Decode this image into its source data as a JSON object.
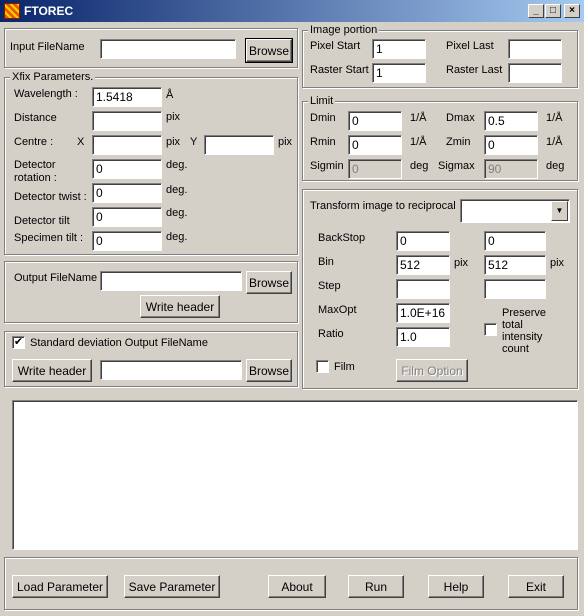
{
  "window": {
    "title": "FTOREC",
    "controls": {
      "minimize": "_",
      "maximize": "□",
      "close": "×"
    }
  },
  "input_file": {
    "label": "Input FileName",
    "value": "",
    "browse": "Browse"
  },
  "image_portion": {
    "title": "Image portion",
    "pixel_start": {
      "label": "Pixel Start",
      "value": "1"
    },
    "pixel_last": {
      "label": "Pixel Last",
      "value": ""
    },
    "raster_start": {
      "label": "Raster Start",
      "value": "1"
    },
    "raster_last": {
      "label": "Raster Last",
      "value": ""
    }
  },
  "xfix": {
    "title": "Xfix Parameters.",
    "wavelength": {
      "label": "Wavelength :",
      "value": "1.5418",
      "unit": "Å"
    },
    "distance": {
      "label": "Distance",
      "value": "",
      "unit": "pix"
    },
    "centre": {
      "label": "Centre :",
      "x_label": "X",
      "x_value": "",
      "x_unit": "pix",
      "y_label": "Y",
      "y_value": "",
      "y_unit": "pix"
    },
    "rotation": {
      "label1": "Detector",
      "label2": "rotation :",
      "value": "0",
      "unit": "deg."
    },
    "twist": {
      "label": "Detector twist :",
      "value": "0",
      "unit": "deg."
    },
    "tilt": {
      "label": "Detector tilt",
      "value": "0",
      "unit": "deg."
    },
    "specimen_tilt": {
      "label": "Specimen tilt :",
      "value": "0",
      "unit": "deg."
    }
  },
  "limit": {
    "title": "Limit",
    "dmin": {
      "label": "Dmin",
      "value": "0",
      "unit": "1/Å"
    },
    "dmax": {
      "label": "Dmax",
      "value": "0.5",
      "unit": "1/Å"
    },
    "rmin": {
      "label": "Rmin",
      "value": "0",
      "unit": "1/Å"
    },
    "zmin": {
      "label": "Zmin",
      "value": "0",
      "unit": "1/Å"
    },
    "sigmin": {
      "label": "Sigmin",
      "value": "0",
      "unit": "deg"
    },
    "sigmax": {
      "label": "Sigmax",
      "value": "90",
      "unit": "deg"
    }
  },
  "transform": {
    "label": "Transform image to reciprocal",
    "combo_value": "",
    "backstop": {
      "label": "BackStop",
      "value1": "0",
      "value2": "0"
    },
    "bin": {
      "label": "Bin",
      "value1": "512",
      "unit1": "pix",
      "value2": "512",
      "unit2": "pix"
    },
    "step": {
      "label": "Step",
      "value1": "",
      "value2": ""
    },
    "maxopt": {
      "label": "MaxOpt",
      "value": "1.0E+16"
    },
    "ratio": {
      "label": "Ratio",
      "value": "1.0"
    },
    "preserve": {
      "checked": false,
      "line1": "Preserve",
      "line2": "total",
      "line3": "intensity",
      "line4": "count"
    },
    "film": {
      "checked": false,
      "label": "Film"
    },
    "film_option": "Film Option"
  },
  "output_file": {
    "label": "Output FileName",
    "value": "",
    "browse": "Browse",
    "write_header": "Write header"
  },
  "stddev": {
    "checked": true,
    "check_mark": "✔",
    "label": "Standard deviation Output FileName",
    "write_header": "Write header",
    "value": "",
    "browse": "Browse"
  },
  "log": {
    "text": ""
  },
  "footer": {
    "load": "Load Parameter",
    "save": "Save Parameter",
    "about": "About",
    "run": "Run",
    "help": "Help",
    "exit": "Exit"
  }
}
